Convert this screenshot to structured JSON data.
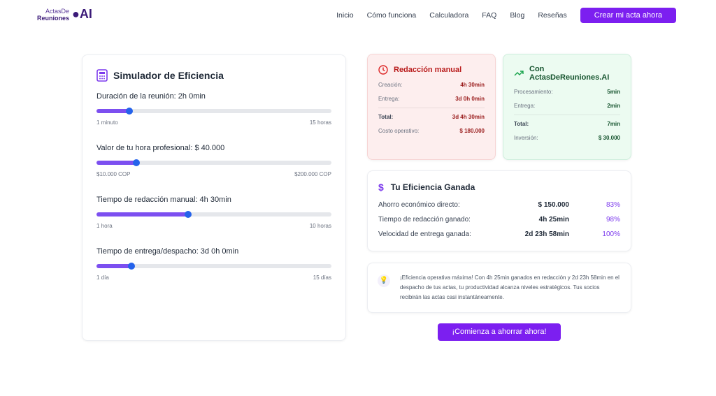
{
  "nav": {
    "logo_line1": "ActasDe",
    "logo_line2": "Reuniones",
    "logo_mark": "AI",
    "items": [
      "Inicio",
      "Cómo funciona",
      "Calculadora",
      "FAQ",
      "Blog",
      "Reseñas"
    ],
    "cta": "Crear mi acta ahora"
  },
  "simulator": {
    "title": "Simulador de Eficiencia",
    "sliders": [
      {
        "label": "Duración de la reunión: 2h 0min",
        "min": "1 minuto",
        "max": "15 horas",
        "percent": 14
      },
      {
        "label": "Valor de tu hora profesional: $ 40.000",
        "min": "$10.000 COP",
        "max": "$200.000 COP",
        "percent": 17
      },
      {
        "label": "Tiempo de redacción manual: 4h 30min",
        "min": "1 hora",
        "max": "10 horas",
        "percent": 39
      },
      {
        "label": "Tiempo de entrega/despacho: 3d 0h 0min",
        "min": "1 día",
        "max": "15 días",
        "percent": 15
      }
    ]
  },
  "manual": {
    "title": "Redacción manual",
    "rows": [
      [
        "Creación:",
        "4h 30min"
      ],
      [
        "Entrega:",
        "3d 0h 0min"
      ],
      [
        "Total:",
        "3d 4h 30min"
      ],
      [
        "Costo operativo:",
        "$ 180.000"
      ]
    ]
  },
  "ai": {
    "title_line1": "Con",
    "title_line2": "ActasDeReuniones.AI",
    "rows": [
      [
        "Procesamiento:",
        "5min"
      ],
      [
        "Entrega:",
        "2min"
      ],
      [
        "Total:",
        "7min"
      ],
      [
        "Inversión:",
        "$ 30.000"
      ]
    ]
  },
  "efficiency": {
    "title": "Tu Eficiencia Ganada",
    "rows": [
      [
        "Ahorro económico directo:",
        "$ 150.000",
        "83%"
      ],
      [
        "Tiempo de redacción ganado:",
        "4h 25min",
        "98%"
      ],
      [
        "Velocidad de entrega ganada:",
        "2d 23h 58min",
        "100%"
      ]
    ]
  },
  "tip": "¡Eficiencia operativa máxima! Con 4h 25min ganados en redacción y 2d 23h 58min en el despacho de tus actas, tu productividad alcanza niveles estratégicos. Tus socios recibirán las actas casi instantáneamente.",
  "cta": "¡Comienza a ahorrar ahora!",
  "colors": {
    "accent": "#7c1ff0",
    "slider_fill": "#7c4ff0",
    "knob": "#2563eb",
    "manual": "#b91c1c",
    "ai": "#15803d"
  }
}
